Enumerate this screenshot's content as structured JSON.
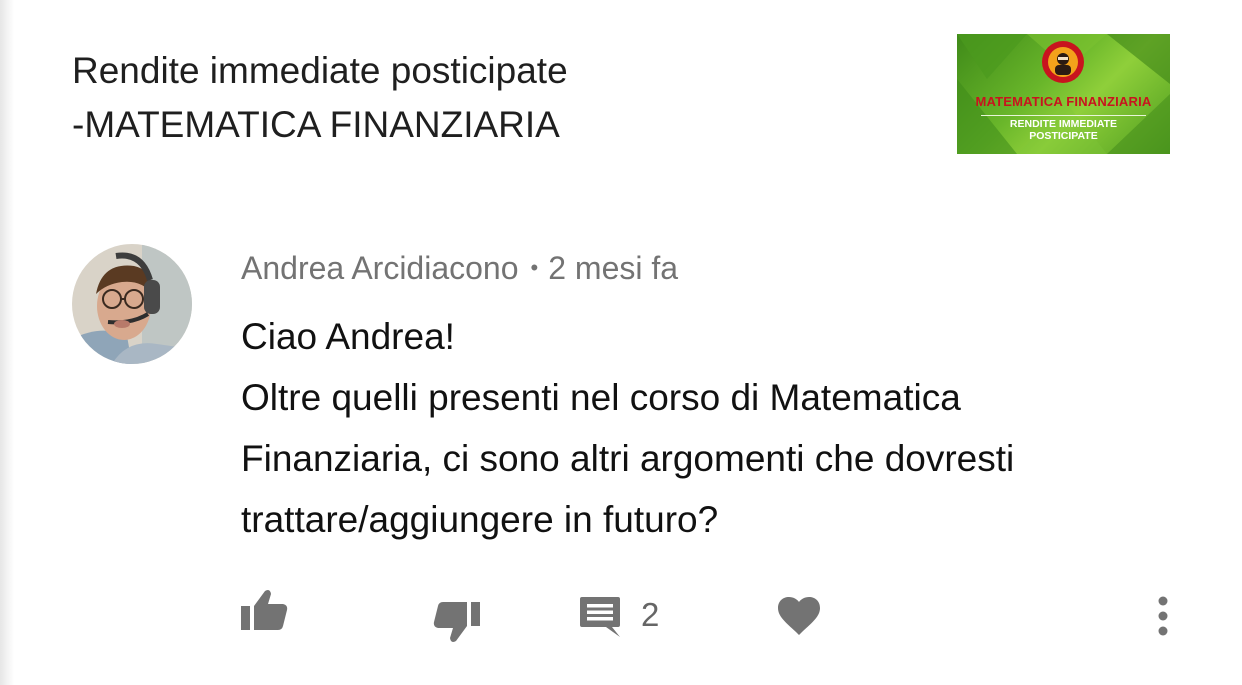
{
  "video": {
    "title_line1": "Rendite immediate posticipate",
    "title_line2": "-MATEMATICA FINANZIARIA",
    "thumbnail": {
      "title": "MATEMATICA FINANZIARIA",
      "subtitle_line1": "RENDITE IMMEDIATE",
      "subtitle_line2": "POSTICIPATE",
      "background_color": "#6ab52b",
      "title_color": "#c8141e"
    }
  },
  "comment": {
    "author": "Andrea Arcidiacono",
    "separator": "•",
    "time": "2 mesi fa",
    "text_lines": [
      "Ciao Andrea!",
      "Oltre quelli presenti nel corso di Matematica",
      "Finanziaria, ci sono altri argomenti che dovresti",
      "trattare/aggiungere in futuro?"
    ]
  },
  "actions": {
    "like_icon": "thumbs-up-icon",
    "dislike_icon": "thumbs-down-icon",
    "reply_icon": "comment-icon",
    "reply_count": "2",
    "heart_icon": "heart-icon",
    "more_icon": "more-vertical-icon",
    "icon_color": "#737373"
  }
}
